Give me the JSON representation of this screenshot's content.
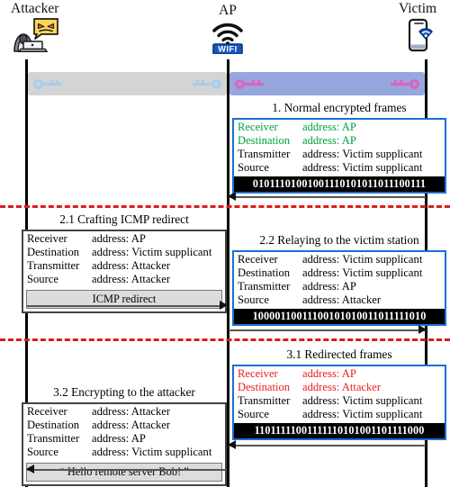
{
  "actors": [
    {
      "id": "attacker",
      "label": "Attacker",
      "icon": "hacker-laptop-icon"
    },
    {
      "id": "ap",
      "label": "AP",
      "icon": "wifi-access-point-icon"
    },
    {
      "id": "victim",
      "label": "Victim",
      "icon": "smartphone-wifi-icon"
    }
  ],
  "key_bars": [
    {
      "id": "attacker-ap",
      "span": "Attacker to AP",
      "color": "#d4d4d4",
      "key_color": "#a8cdee",
      "icon": "key-icon"
    },
    {
      "id": "ap-victim",
      "span": "AP to Victim",
      "color": "#95a7dd",
      "key_color": "#d965c4",
      "icon": "key-icon"
    }
  ],
  "address_labels": {
    "receiver": "Receiver",
    "destination": "Destination",
    "transmitter": "Transmitter",
    "source": "Source",
    "addr_prefix": "address:"
  },
  "colors": {
    "highlight_green": "#00a33c",
    "highlight_red": "#ee1c1c",
    "frame_border_blue": "#1a6fd4",
    "frame_border_black": "#444444",
    "divider_red": "#e01b1b",
    "encrypted_payload_bg": "#000000",
    "plain_payload_bg": "#dcdcdc"
  },
  "phases": [
    {
      "id": "phase-1",
      "title": "1. Normal encrypted frames",
      "side": "right",
      "border": "blue",
      "rows": [
        {
          "field": "Receiver",
          "value": "address: AP",
          "color": "green"
        },
        {
          "field": "Destination",
          "value": "address: AP",
          "color": "green"
        },
        {
          "field": "Transmitter",
          "value": "address: Victim supplicant",
          "color": "black"
        },
        {
          "field": "Source",
          "value": "address: Victim supplicant",
          "color": "black"
        }
      ],
      "payload": {
        "type": "encrypted",
        "value": "01011101001001110101011011100111"
      }
    },
    {
      "id": "phase-2-1",
      "title": "2.1 Crafting ICMP redirect",
      "side": "left",
      "border": "black",
      "rows": [
        {
          "field": "Receiver",
          "value": "address: AP",
          "color": "black"
        },
        {
          "field": "Destination",
          "value": "address: Victim supplicant",
          "color": "black"
        },
        {
          "field": "Transmitter",
          "value": "address: Attacker",
          "color": "black"
        },
        {
          "field": "Source",
          "value": "address: Attacker",
          "color": "black"
        }
      ],
      "payload": {
        "type": "plain",
        "value": "ICMP redirect"
      }
    },
    {
      "id": "phase-2-2",
      "title": "2.2 Relaying to the victim station",
      "side": "right",
      "border": "blue",
      "rows": [
        {
          "field": "Receiver",
          "value": "address: Victim supplicant",
          "color": "black"
        },
        {
          "field": "Destination",
          "value": "address: Victim supplicant",
          "color": "black"
        },
        {
          "field": "Transmitter",
          "value": "address: AP",
          "color": "black"
        },
        {
          "field": "Source",
          "value": "address: Attacker",
          "color": "black"
        }
      ],
      "payload": {
        "type": "encrypted",
        "value": "10000110011100101010011011111010"
      }
    },
    {
      "id": "phase-3-1",
      "title": "3.1 Redirected frames",
      "side": "right",
      "border": "blue",
      "rows": [
        {
          "field": "Receiver",
          "value": "address: AP",
          "color": "red"
        },
        {
          "field": "Destination",
          "value": "address: Attacker",
          "color": "red"
        },
        {
          "field": "Transmitter",
          "value": "address: Victim supplicant",
          "color": "black"
        },
        {
          "field": "Source",
          "value": "address: Victim supplicant",
          "color": "black"
        }
      ],
      "payload": {
        "type": "encrypted",
        "value": "11011111001111110101001101111000"
      }
    },
    {
      "id": "phase-3-2",
      "title": "3.2 Encrypting to the attacker",
      "side": "left",
      "border": "black",
      "rows": [
        {
          "field": "Receiver",
          "value": "address: Attacker",
          "color": "black"
        },
        {
          "field": "Destination",
          "value": "address: Attacker",
          "color": "black"
        },
        {
          "field": "Transmitter",
          "value": "address: AP",
          "color": "black"
        },
        {
          "field": "Source",
          "value": "address: Victim supplicant",
          "color": "black"
        }
      ],
      "payload": {
        "type": "plain",
        "value": "“ Hello remote server Bob! ”"
      }
    }
  ],
  "messages": [
    {
      "id": "msg-1",
      "direction": "left",
      "from": "Victim",
      "to": "AP"
    },
    {
      "id": "msg-2-1",
      "direction": "right",
      "from": "Attacker",
      "to": "AP"
    },
    {
      "id": "msg-2-2",
      "direction": "right",
      "from": "AP",
      "to": "Victim"
    },
    {
      "id": "msg-3-1",
      "direction": "left",
      "from": "Victim",
      "to": "AP"
    },
    {
      "id": "msg-3-2",
      "direction": "left",
      "from": "AP",
      "to": "Attacker"
    }
  ]
}
